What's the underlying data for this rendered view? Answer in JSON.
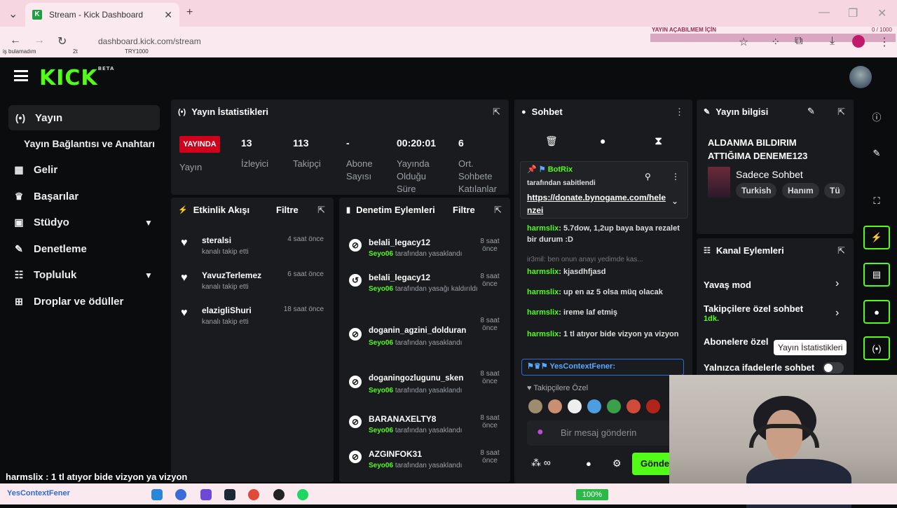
{
  "browser": {
    "tab_title": "Stream - Kick Dashboard",
    "url": "dashboard.kick.com/stream",
    "bookmarks": [
      "iş bulamadım",
      "2t",
      "TRY1000"
    ],
    "overlay_title": "YAYIN AÇABILMEM İÇİN",
    "overlay_count": "0 / 1000"
  },
  "header": {
    "logo": "KICK",
    "logo_badge": "BETA"
  },
  "sidebar": {
    "items": [
      {
        "label": "Yayın",
        "icon": "broadcast-icon"
      },
      {
        "label": "Yayın Bağlantısı ve Anahtarı"
      },
      {
        "label": "Gelir",
        "icon": "chart-icon"
      },
      {
        "label": "Başarılar",
        "icon": "trophy-icon"
      },
      {
        "label": "Stüdyo",
        "icon": "studio-icon"
      },
      {
        "label": "Denetleme",
        "icon": "wrench-icon"
      },
      {
        "label": "Topluluk",
        "icon": "users-icon"
      },
      {
        "label": "Droplar ve ödüller",
        "icon": "gift-icon"
      }
    ]
  },
  "stats": {
    "title": "Yayın İstatistikleri",
    "live_badge": "YAYINDA",
    "live_label": "Yayın",
    "values": [
      "13",
      "113",
      "-",
      "00:20:01",
      "6"
    ],
    "labels": [
      "İzleyici",
      "Takipçi",
      "Abone Sayısı",
      "Yayında Olduğu Süre",
      "Ort. Sohbete Katılanlar"
    ]
  },
  "activity": {
    "title": "Etkinlik Akışı",
    "filter": "Filtre",
    "items": [
      {
        "name": "steralsi",
        "time": "4 saat önce",
        "sub": "kanalı takip etti"
      },
      {
        "name": "YavuzTerlemez",
        "time": "6 saat önce",
        "sub": "kanalı takip etti"
      },
      {
        "name": "elazigliShuri",
        "time": "18 saat önce",
        "sub": "kanalı takip etti"
      }
    ]
  },
  "moderation": {
    "title": "Denetim Eylemleri",
    "filter": "Filtre",
    "items": [
      {
        "name": "belali_legacy12",
        "time": "8 saat önce",
        "mod": "Seyo06",
        "action": "tarafından yasaklandı"
      },
      {
        "name": "belali_legacy12",
        "time": "8 saat önce",
        "mod": "Seyo06",
        "action": "tarafından yasağı kaldırıldı"
      },
      {
        "name": "doganin_agzini_dolduran",
        "time": "8 saat önce",
        "mod": "Seyo06",
        "action": "tarafından yasaklandı"
      },
      {
        "name": "doganingozlugunu_sken",
        "time": "8 saat önce",
        "mod": "Seyo06",
        "action": "tarafından yasaklandı"
      },
      {
        "name": "BARANAXELTY8",
        "time": "8 saat önce",
        "mod": "Seyo06",
        "action": "tarafından yasaklandı"
      },
      {
        "name": "AZGINFOK31",
        "time": "8 saat önce",
        "mod": "Seyo06",
        "action": "tarafından yasaklandı"
      }
    ]
  },
  "chat": {
    "title": "Sohbet",
    "pinned_user": "BotRix",
    "pinned_by": "tarafından sabitlendi",
    "pinned_link": "https://donate.bynogame.com/helenzei",
    "reply_preview": "ir3mil: ben onun anayı yedimde kas...",
    "messages": [
      {
        "user": "harmslix",
        "text": "5.7dow, 1,2up baya baya rezalet bir durum :D"
      },
      {
        "user": "harmslix",
        "text": "kjasdhfjasd"
      },
      {
        "user": "harmslix",
        "text": "up en az 5 olsa müq olacak"
      },
      {
        "user": "harmslix",
        "text": "ireme laf etmiş"
      },
      {
        "user": "harmslix",
        "text": "1 tl atıyor bide vizyon ya vizyon"
      }
    ],
    "last_user": "YesContextFener",
    "emote_section": "Takipçilere Özel",
    "input_placeholder": "Bir mesaj gönderin",
    "send_button": "Gönder"
  },
  "stream_info": {
    "title": "Yayın bilgisi",
    "stream_title": "ALDANMA BILDIRIM ATTIĞIMA DENEME123",
    "category": "Sadece Sohbet",
    "tags": [
      "Turkish",
      "Hanım",
      "Tü"
    ]
  },
  "channel_actions": {
    "title": "Kanal Eylemleri",
    "slow_mode": "Yavaş mod",
    "followers_only": "Takipçilere özel sohbet",
    "followers_only_sub": "1dk.",
    "subs_only": "Abonelere özel",
    "emotes_only": "Yalnızca ifadelerle sohbet"
  },
  "tooltip": "Yayın İstatistikleri",
  "overlay_chat": "harmslix : 1 tl atıyor bide vizyon ya vizyon",
  "taskbar": {
    "battery": "100%",
    "overlay_name": "YesContextFener"
  },
  "colors": {
    "accent": "#53fc18",
    "live": "#d0021b",
    "panel": "#191b1f"
  }
}
